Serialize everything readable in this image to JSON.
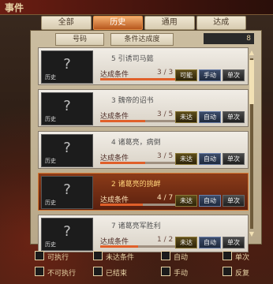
{
  "header": {
    "title": "事件"
  },
  "tabs": [
    {
      "label": "全部",
      "active": false
    },
    {
      "label": "历史",
      "active": true
    },
    {
      "label": "通用",
      "active": false
    },
    {
      "label": "达成",
      "active": false
    }
  ],
  "sort": {
    "left": "号码",
    "right": "条件达成度",
    "count": "8"
  },
  "events": [
    {
      "name": "5 引诱司马懿",
      "cond": "达成条件",
      "progress": "3 / 3",
      "fraction": 1.0,
      "thumb_label": "历史",
      "buttons": [
        "可能",
        "手动",
        "单次"
      ],
      "highlight": false
    },
    {
      "name": "3 魏帝的诏书",
      "cond": "达成条件",
      "progress": "3 / 5",
      "fraction": 0.6,
      "thumb_label": "历史",
      "buttons": [
        "未达",
        "自动",
        "单次"
      ],
      "highlight": false
    },
    {
      "name": "4 诸葛亮，病倒",
      "cond": "达成条件",
      "progress": "3 / 5",
      "fraction": 0.6,
      "thumb_label": "历史",
      "buttons": [
        "未达",
        "自动",
        "单次"
      ],
      "highlight": false
    },
    {
      "name": "2 诸葛亮的挑衅",
      "cond": "达成条件",
      "progress": "4 / 7",
      "fraction": 0.57,
      "thumb_label": "历史",
      "buttons": [
        "未达",
        "自动",
        "单次"
      ],
      "highlight": true
    },
    {
      "name": "7 诸葛亮军胜利",
      "cond": "达成条件",
      "progress": "1 / 2",
      "fraction": 0.5,
      "thumb_label": "历史",
      "buttons": [
        "未达",
        "自动",
        "单次"
      ],
      "highlight": false
    }
  ],
  "filters": [
    {
      "label": "可执行"
    },
    {
      "label": "未达条件"
    },
    {
      "label": "自动"
    },
    {
      "label": "单次"
    },
    {
      "label": "不可执行"
    },
    {
      "label": "已结束"
    },
    {
      "label": "手动"
    },
    {
      "label": "反复"
    }
  ],
  "colors": {
    "accent": "#e0602a",
    "highlight": "#8b3b18",
    "panel": "#cbbda0"
  }
}
